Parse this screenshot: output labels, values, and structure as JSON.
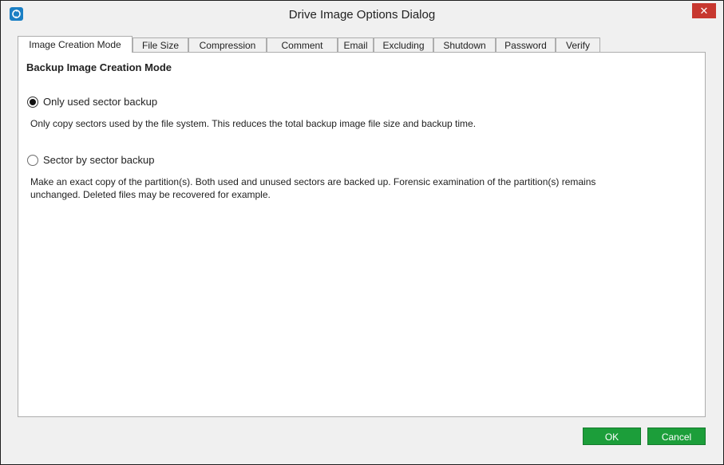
{
  "window": {
    "title": "Drive Image Options Dialog",
    "close_label": "✕"
  },
  "tabs": [
    {
      "label": "Image Creation Mode",
      "active": true
    },
    {
      "label": "File Size"
    },
    {
      "label": "Compression"
    },
    {
      "label": "Comment"
    },
    {
      "label": "Email"
    },
    {
      "label": "Excluding"
    },
    {
      "label": "Shutdown"
    },
    {
      "label": "Password"
    },
    {
      "label": "Verify"
    }
  ],
  "panel": {
    "heading": "Backup Image Creation Mode",
    "options": [
      {
        "label": "Only used sector backup",
        "selected": true,
        "description": "Only copy sectors used by the file system. This reduces the total backup image file size and backup time."
      },
      {
        "label": "Sector by sector backup",
        "selected": false,
        "description_line1": "Make an exact copy of the partition(s). Both used and unused sectors are backed up. Forensic examination of the partition(s) remains",
        "description_line2": "unchanged. Deleted files may be recovered for example."
      }
    ]
  },
  "buttons": {
    "ok": "OK",
    "cancel": "Cancel"
  },
  "colors": {
    "button_green": "#1c9e3a",
    "close_red": "#c7372f",
    "app_icon_blue": "#1a7fc4"
  }
}
